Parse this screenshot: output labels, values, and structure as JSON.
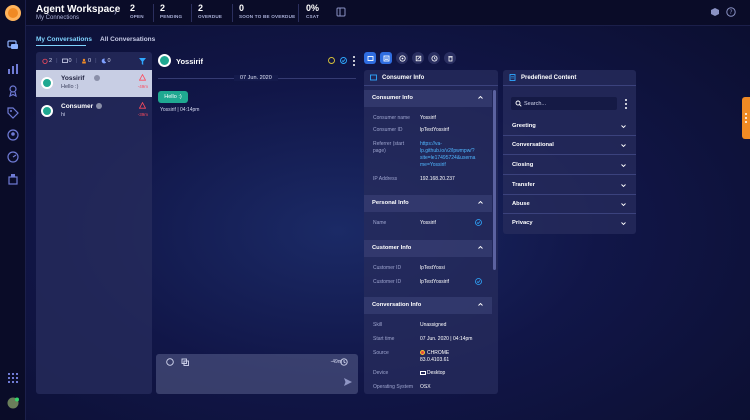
{
  "header": {
    "title": "Agent Workspace",
    "subtitle": "My Connections",
    "stats": [
      {
        "num": "2",
        "label": "OPEN"
      },
      {
        "num": "2",
        "label": "PENDING"
      },
      {
        "num": "2",
        "label": "OVERDUE"
      },
      {
        "num": "0",
        "label": "SOON TO BE OVERDUE"
      },
      {
        "num": "0%",
        "label": "CSAT"
      }
    ]
  },
  "tabs": {
    "my": "My Conversations",
    "all": "All Conversations"
  },
  "filters": {
    "alerts": "2",
    "messages": "0",
    "waiting": "0",
    "night": "0"
  },
  "conversations": [
    {
      "name": "Yossirif",
      "message": "Hello :)",
      "time": "-49m"
    },
    {
      "name": "Consumer",
      "message": "hi",
      "time": "-39m"
    }
  ],
  "chat": {
    "name": "Yossirif",
    "date": "07 Jun. 2020",
    "message": "Hello :)",
    "meta": "Yossirif | 04:14pm",
    "counter": "-49m",
    "input_placeholder": ""
  },
  "consumer_info": {
    "title": "Consumer Info",
    "sections": {
      "consumer": "Consumer Info",
      "personal": "Personal Info",
      "customer": "Customer Info",
      "conversation": "Conversation Info"
    },
    "consumer_name_label": "Consumer name",
    "consumer_name": "Yossirif",
    "consumer_id_label": "Consumer ID",
    "consumer_id": "lpTestYossirif",
    "referrer_label": "Referrer (start page)",
    "referrer_lines": [
      "https://va-",
      "lp.github.io/v2/lpwmpw/?",
      "site=le17495724&userna",
      "me=Yossirif"
    ],
    "ip_label": "IP Address",
    "ip": "192.168.20.237",
    "name_label": "Name",
    "name": "Yossirif",
    "customer_id_label": "Customer ID",
    "customer_id": "lpTestYossi",
    "customer_id2_label": "Customer ID",
    "customer_id2": "lpTestYossirif",
    "skill_label": "Skill",
    "skill": "Unassigned",
    "start_label": "Start time",
    "start": "07 Jun. 2020 | 04:14pm",
    "source_label": "Source",
    "source": "CHROME",
    "source_ver": "83.0.4103.61",
    "device_label": "Device",
    "device": "Desktop",
    "os_label": "Operating System",
    "os": "OSX"
  },
  "predefined": {
    "title": "Predefined Content",
    "search_placeholder": "Search...",
    "categories": [
      "Greeting",
      "Conversational",
      "Closing",
      "Transfer",
      "Abuse",
      "Privacy"
    ]
  }
}
